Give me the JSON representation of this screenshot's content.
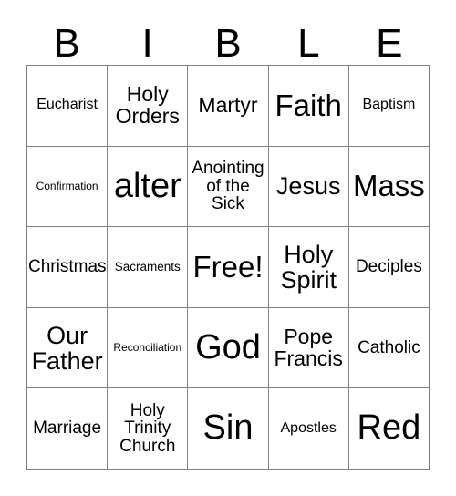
{
  "card": {
    "title_letters": [
      "B",
      "I",
      "B",
      "L",
      "E"
    ],
    "grid_size": "5x5",
    "free_space_label": "Free!",
    "colors": {
      "background": "#ffffff",
      "text": "#000000",
      "grid_line": "#808080"
    },
    "rows": [
      [
        {
          "label": "Eucharist",
          "size": "s"
        },
        {
          "label": "Holy\nOrders",
          "size": "l"
        },
        {
          "label": "Martyr",
          "size": "l"
        },
        {
          "label": "Faith",
          "size": "xxl"
        },
        {
          "label": "Baptism",
          "size": "s"
        }
      ],
      [
        {
          "label": "Confirmation",
          "size": "xxs"
        },
        {
          "label": "alter",
          "size": "huge"
        },
        {
          "label": "Anointing\nof the\nSick",
          "size": "m"
        },
        {
          "label": "Jesus",
          "size": "xl"
        },
        {
          "label": "Mass",
          "size": "xxl"
        }
      ],
      [
        {
          "label": "Christmas",
          "size": "m"
        },
        {
          "label": "Sacraments",
          "size": "xs"
        },
        {
          "label": "Free!",
          "size": "xxl"
        },
        {
          "label": "Holy\nSpirit",
          "size": "xl"
        },
        {
          "label": "Deciples",
          "size": "m"
        }
      ],
      [
        {
          "label": "Our\nFather",
          "size": "xl"
        },
        {
          "label": "Reconciliation",
          "size": "xxs"
        },
        {
          "label": "God",
          "size": "huge"
        },
        {
          "label": "Pope\nFrancis",
          "size": "l"
        },
        {
          "label": "Catholic",
          "size": "m"
        }
      ],
      [
        {
          "label": "Marriage",
          "size": "m"
        },
        {
          "label": "Holy\nTrinity\nChurch",
          "size": "m"
        },
        {
          "label": "Sin",
          "size": "huge"
        },
        {
          "label": "Apostles",
          "size": "s"
        },
        {
          "label": "Red",
          "size": "huge"
        }
      ]
    ]
  }
}
